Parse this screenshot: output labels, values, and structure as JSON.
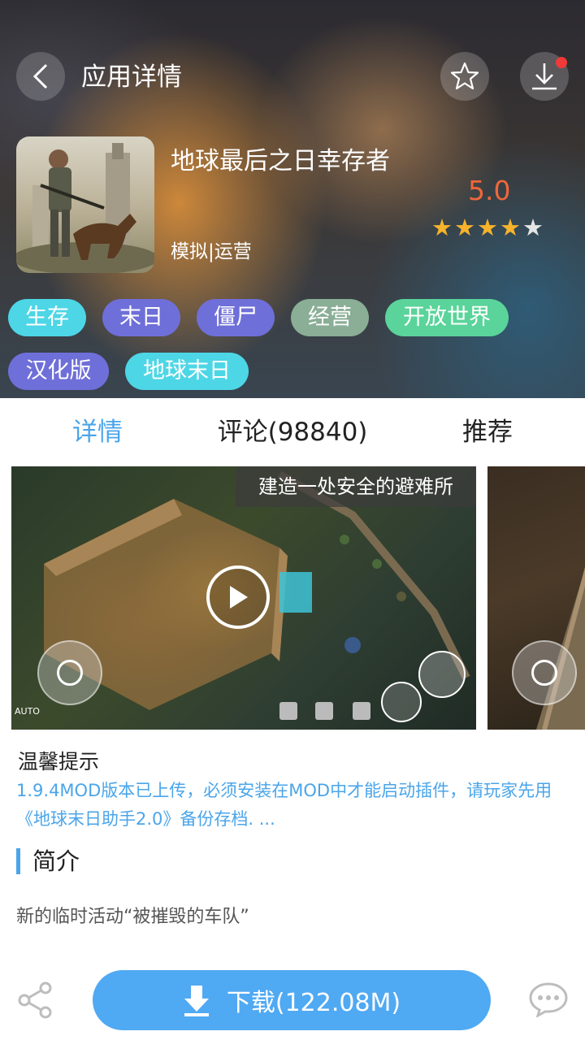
{
  "header": {
    "title": "应用详情",
    "app_name": "地球最后之日幸存者",
    "category": "模拟|运营",
    "score": "5.0",
    "rating_stars": 4,
    "rating_max": 5,
    "tags": [
      {
        "label": "生存",
        "color": "#4dd6e6"
      },
      {
        "label": "末日",
        "color": "#6f6fd9"
      },
      {
        "label": "僵尸",
        "color": "#6f6fd9"
      },
      {
        "label": "经营",
        "color": "#8aae96"
      },
      {
        "label": "开放世界",
        "color": "#5ad49a"
      },
      {
        "label": "汉化版",
        "color": "#6f6fd9"
      },
      {
        "label": "地球末日",
        "color": "#4dd6e6"
      }
    ]
  },
  "tabs": [
    {
      "label": "详情",
      "active": true
    },
    {
      "label": "评论(98840)",
      "active": false
    },
    {
      "label": "推荐",
      "active": false
    }
  ],
  "screenshot": {
    "caption": "建造一处安全的避难所",
    "auto_label": "AUTO"
  },
  "tip": {
    "title": "温馨提示",
    "body": "1.9.4MOD版本已上传，必须安装在MOD中才能启动插件，请玩家先用《地球末日助手2.0》备份存档. ..."
  },
  "intro": {
    "title": "简介",
    "text": "新的临时活动“被摧毁的车队”"
  },
  "bottom": {
    "download_label": "下载(122.08M)"
  },
  "colors": {
    "accent": "#4aa5ea",
    "score": "#f0663a",
    "download": "#50a9f3"
  }
}
